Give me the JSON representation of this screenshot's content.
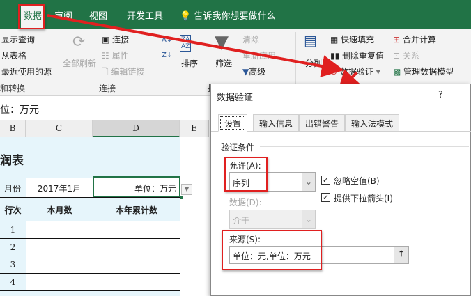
{
  "tabs": [
    "数据",
    "审阅",
    "视图",
    "开发工具"
  ],
  "tell_me": "告诉我你想要做什么",
  "ribbon": {
    "get_transform": {
      "items": [
        "显示查询",
        "从表格",
        "最近使用的源"
      ],
      "label": "和转换"
    },
    "connections": {
      "refresh_all": "全部刷新",
      "items": [
        "连接",
        "属性",
        "编辑链接"
      ],
      "label": "连接"
    },
    "sort_filter": {
      "sort": "排序",
      "filter": "筛选",
      "clear": "清除",
      "reapply": "重新应用",
      "advanced": "高级",
      "label": "排"
    },
    "data_tools": {
      "split": "分列",
      "items": [
        "快速填充",
        "删除重复值",
        "数据验证"
      ],
      "items2": [
        "合并计算",
        "关系",
        "管理数据模型"
      ]
    }
  },
  "formula_bar": {
    "value": "位：万元"
  },
  "columns": [
    "B",
    "C",
    "D",
    "E"
  ],
  "sheet": {
    "title": "润表",
    "month_label": "月份",
    "month_value": "2017年1月",
    "unit": "单位：万元",
    "headers": [
      "行次",
      "本月数",
      "本年累计数"
    ],
    "rows": [
      "1",
      "2",
      "3",
      "4"
    ]
  },
  "dialog": {
    "title": "数据验证",
    "help": "?",
    "tabs": [
      "设置",
      "输入信息",
      "出错警告",
      "输入法模式"
    ],
    "section": "验证条件",
    "allow_label": "允许(A):",
    "allow_value": "序列",
    "data_label": "数据(D):",
    "data_value": "介于",
    "ignore_blank": "忽略空值(B)",
    "dropdown": "提供下拉箭头(I)",
    "source_label": "来源(S):",
    "source_value": "单位：元,单位：万元"
  },
  "colors": {
    "excel_green": "#217346",
    "annotation_red": "#e02020"
  }
}
